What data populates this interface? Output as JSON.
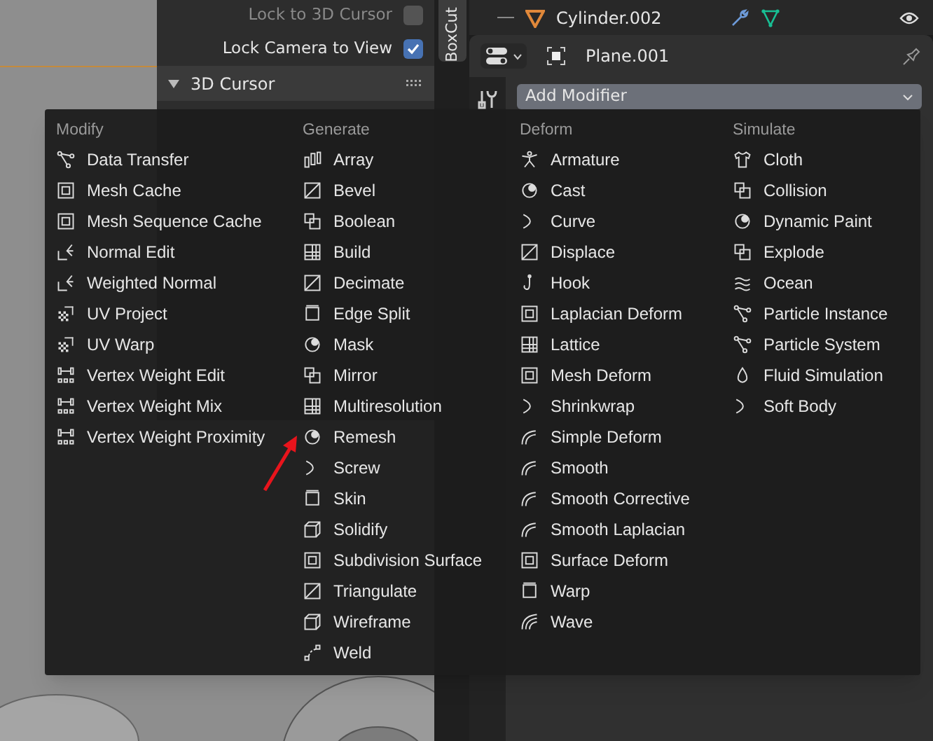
{
  "viewport_sidebar": {
    "options": [
      {
        "label": "Lock to 3D Cursor",
        "checked": false
      },
      {
        "label": "Lock Camera to View",
        "checked": true
      }
    ],
    "panel": {
      "title": "3D Cursor",
      "expanded": true
    },
    "tab": "BoxCut"
  },
  "outliner": {
    "rows": [
      {
        "name": "Cylinder.002"
      }
    ]
  },
  "properties": {
    "object_name": "Plane.001",
    "add_modifier": "Add Modifier"
  },
  "menu": {
    "columns": [
      {
        "title": "Modify",
        "items": [
          "Data Transfer",
          "Mesh Cache",
          "Mesh Sequence Cache",
          "Normal Edit",
          "Weighted Normal",
          "UV Project",
          "UV Warp",
          "Vertex Weight Edit",
          "Vertex Weight Mix",
          "Vertex Weight Proximity"
        ]
      },
      {
        "title": "Generate",
        "items": [
          "Array",
          "Bevel",
          "Boolean",
          "Build",
          "Decimate",
          "Edge Split",
          "Mask",
          "Mirror",
          "Multiresolution",
          "Remesh",
          "Screw",
          "Skin",
          "Solidify",
          "Subdivision Surface",
          "Triangulate",
          "Wireframe",
          "Weld"
        ]
      },
      {
        "title": "Deform",
        "items": [
          "Armature",
          "Cast",
          "Curve",
          "Displace",
          "Hook",
          "Laplacian Deform",
          "Lattice",
          "Mesh Deform",
          "Shrinkwrap",
          "Simple Deform",
          "Smooth",
          "Smooth Corrective",
          "Smooth Laplacian",
          "Surface Deform",
          "Warp",
          "Wave"
        ]
      },
      {
        "title": "Simulate",
        "items": [
          "Cloth",
          "Collision",
          "Dynamic Paint",
          "Explode",
          "Ocean",
          "Particle Instance",
          "Particle System",
          "Fluid Simulation",
          "Soft Body"
        ]
      }
    ]
  }
}
